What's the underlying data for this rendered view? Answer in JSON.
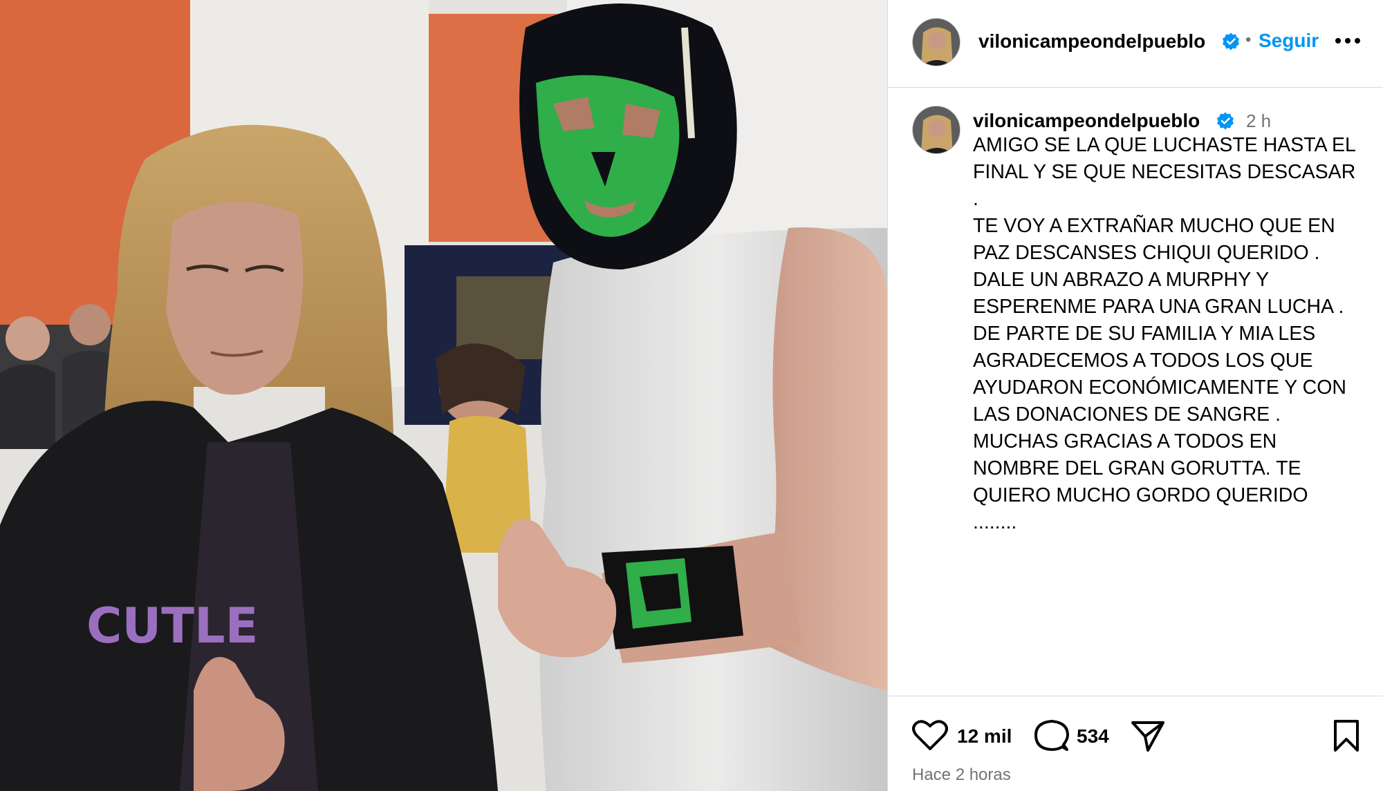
{
  "post": {
    "username": "vilonicampeondelpueblo",
    "follow_label": "Seguir",
    "separator": "•",
    "caption": {
      "username": "vilonicampeondelpueblo",
      "time": "2 h",
      "lines": [
        "AMIGO SE LA QUE LUCHASTE HASTA EL",
        "FINAL Y SE QUE NECESITAS DESCASAR .",
        "TE VOY A EXTRAÑAR MUCHO QUE EN",
        "PAZ DESCANSES CHIQUI QUERIDO .",
        "DALE UN ABRAZO A MURPHY Y",
        "ESPERENME PARA UNA GRAN LUCHA .",
        "DE PARTE DE SU FAMILIA Y MIA LES",
        "AGRADECEMOS A TODOS LOS QUE",
        "AYUDARON ECONÓMICAMENTE Y CON",
        "LAS DONACIONES DE SANGRE .",
        "MUCHAS GRACIAS A TODOS EN",
        "NOMBRE DEL GRAN GORUTTA.  TE",
        "QUIERO MUCHO GORDO QUERIDO",
        "........"
      ]
    },
    "likes": "12 mil",
    "comments": "534",
    "timestamp": "Hace 2 horas",
    "photo_text": "CUTLE",
    "icons": {
      "verified": "verified-badge-icon",
      "more": "more-options-icon",
      "like": "heart-icon",
      "comment": "comment-icon",
      "share": "paper-plane-icon",
      "save": "bookmark-icon"
    },
    "colors": {
      "accent": "#0095f6",
      "secondary_text": "#737373",
      "border": "#dbdbdb",
      "mask_green": "#2fae4a"
    }
  }
}
